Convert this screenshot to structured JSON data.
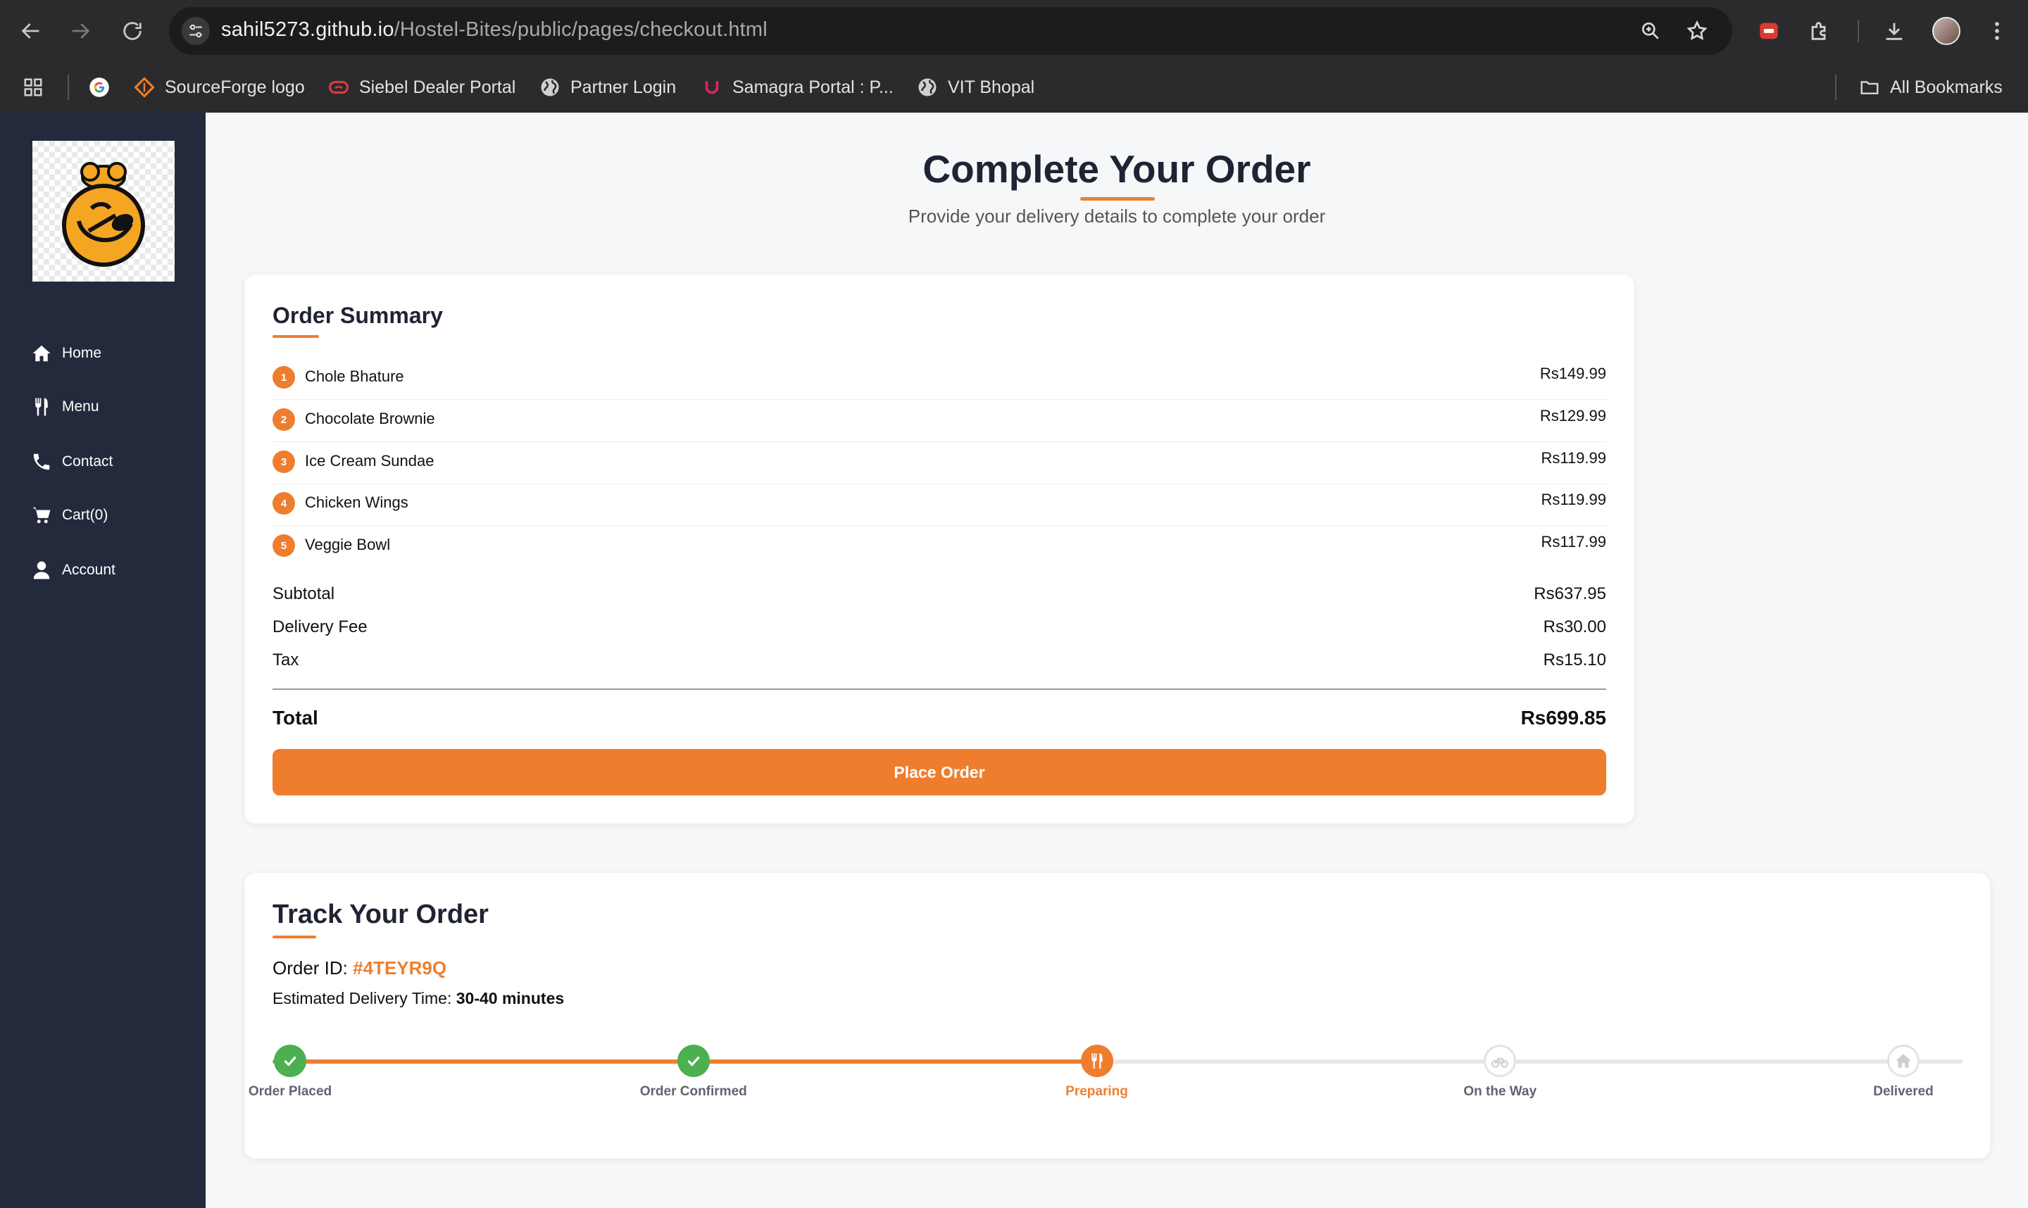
{
  "browser": {
    "url_host": "sahil5273.github.io",
    "url_path": "/Hostel-Bites/public/pages/checkout.html",
    "bookmarks": [
      {
        "label": "SourceForge logo"
      },
      {
        "label": "Siebel Dealer Portal"
      },
      {
        "label": "Partner Login"
      },
      {
        "label": "Samagra Portal : P..."
      },
      {
        "label": "VIT Bhopal"
      }
    ],
    "all_bookmarks": "All Bookmarks"
  },
  "sidebar": {
    "items": [
      {
        "label": "Home",
        "icon": "home-icon"
      },
      {
        "label": "Menu",
        "icon": "utensils-icon"
      },
      {
        "label": "Contact",
        "icon": "phone-icon"
      },
      {
        "label": "Cart(0)",
        "icon": "cart-icon"
      },
      {
        "label": "Account",
        "icon": "user-icon"
      }
    ]
  },
  "page": {
    "title": "Complete Your Order",
    "subtitle": "Provide your delivery details to complete your order"
  },
  "summary": {
    "heading": "Order Summary",
    "items": [
      {
        "num": "1",
        "name": "Chole Bhature",
        "price": "Rs149.99"
      },
      {
        "num": "2",
        "name": "Chocolate Brownie",
        "price": "Rs129.99"
      },
      {
        "num": "3",
        "name": "Ice Cream Sundae",
        "price": "Rs119.99"
      },
      {
        "num": "4",
        "name": "Chicken Wings",
        "price": "Rs119.99"
      },
      {
        "num": "5",
        "name": "Veggie Bowl",
        "price": "Rs117.99"
      }
    ],
    "subtotal_label": "Subtotal",
    "subtotal": "Rs637.95",
    "delivery_label": "Delivery Fee",
    "delivery": "Rs30.00",
    "tax_label": "Tax",
    "tax": "Rs15.10",
    "total_label": "Total",
    "total": "Rs699.85",
    "place_order": "Place Order"
  },
  "track": {
    "heading": "Track Your Order",
    "order_id_label": "Order ID:",
    "order_id": "#4TEYR9Q",
    "eta_label": "Estimated Delivery Time:",
    "eta": "30-40 minutes",
    "progress_fraction": 0.5,
    "steps": [
      {
        "label": "Order Placed",
        "status": "done",
        "icon": "check-icon"
      },
      {
        "label": "Order Confirmed",
        "status": "done",
        "icon": "check-icon"
      },
      {
        "label": "Preparing",
        "status": "active",
        "icon": "utensils-icon"
      },
      {
        "label": "On the Way",
        "status": "pending",
        "icon": "bicycle-icon"
      },
      {
        "label": "Delivered",
        "status": "pending",
        "icon": "home-icon"
      }
    ]
  },
  "colors": {
    "accent": "#ee7e2e",
    "success": "#4caf50",
    "sidebar": "#232a3b"
  }
}
